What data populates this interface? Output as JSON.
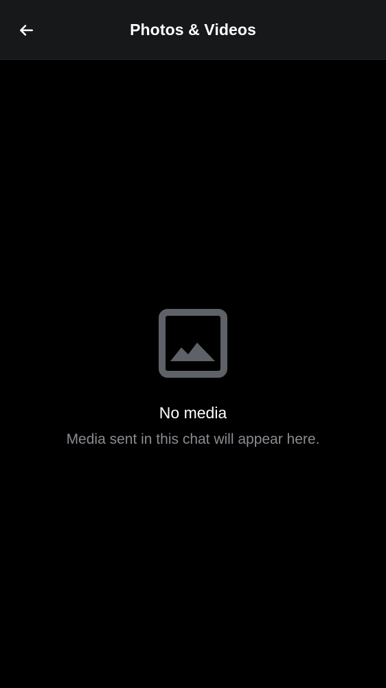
{
  "header": {
    "title": "Photos & Videos",
    "back_icon": "arrow-left-icon"
  },
  "empty_state": {
    "icon": "image-placeholder-icon",
    "title": "No media",
    "subtitle": "Media sent in this chat will appear here."
  },
  "colors": {
    "background": "#000000",
    "header_background": "#17181a",
    "primary_text": "#ffffff",
    "secondary_text": "#8b8c91",
    "icon": "#5e6168"
  }
}
